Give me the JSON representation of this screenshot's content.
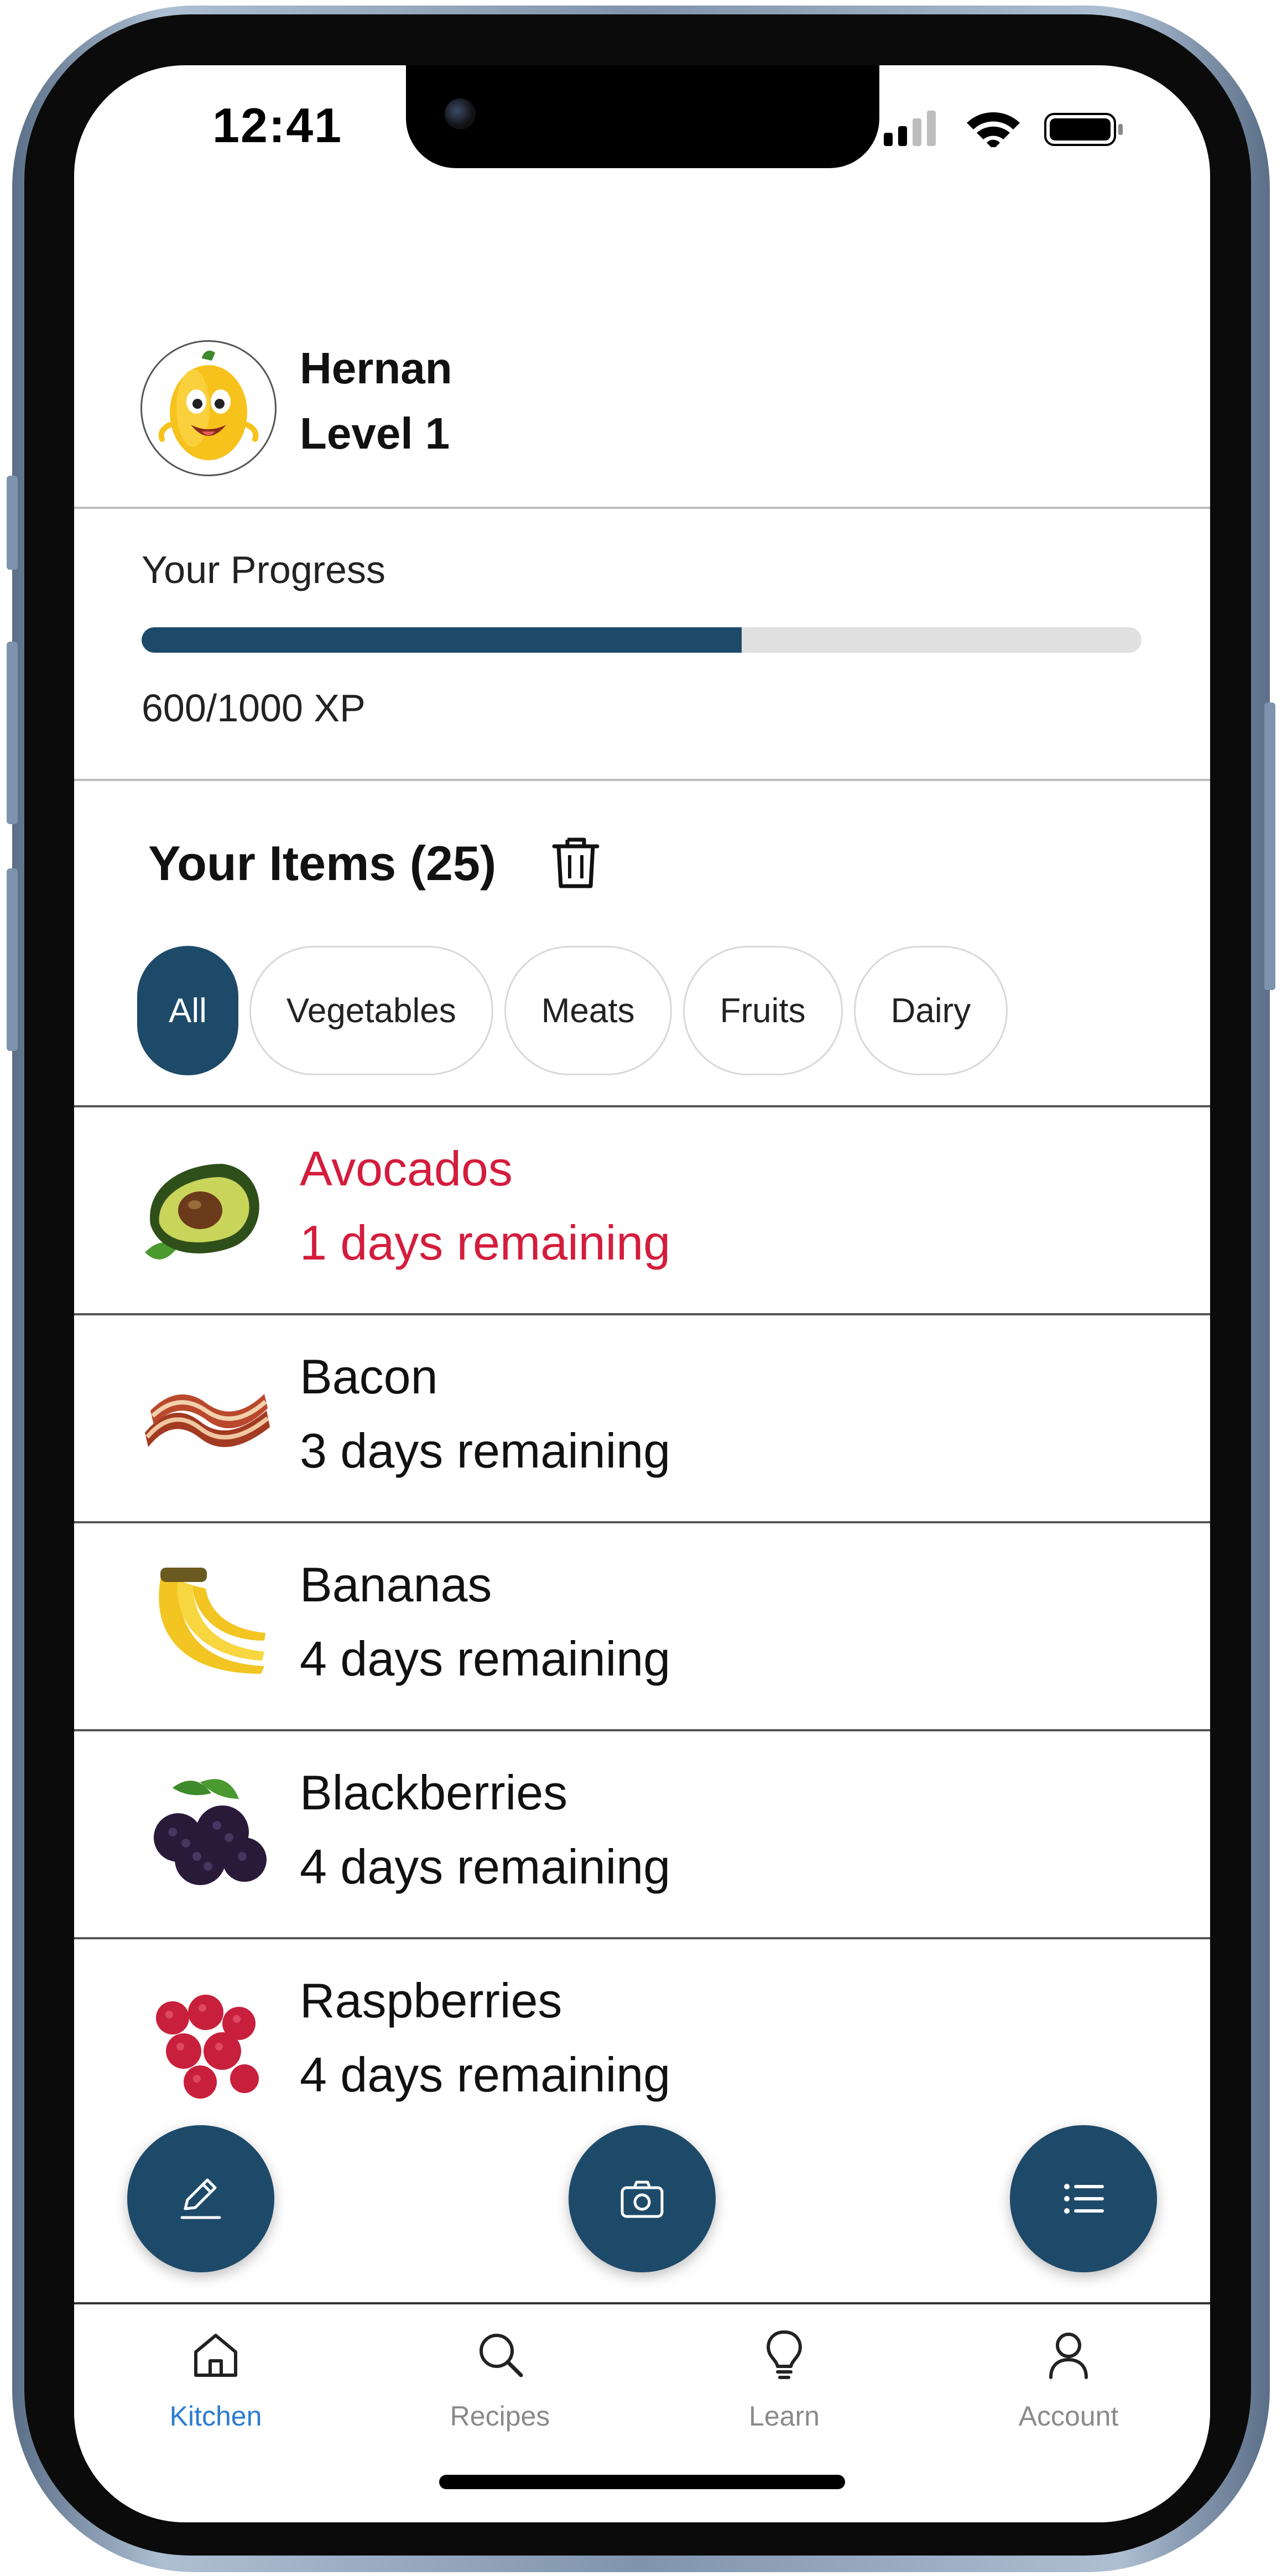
{
  "status_bar": {
    "time": "12:41"
  },
  "profile": {
    "name": "Hernan",
    "level": "Level 1",
    "avatar_icon": "bell-pepper-avatar"
  },
  "progress": {
    "label": "Your Progress",
    "xp_text": "600/1000 XP",
    "fraction": 0.6
  },
  "items_section": {
    "title": "Your Items (25)",
    "filters": [
      "All",
      "Vegetables",
      "Meats",
      "Fruits",
      "Dairy"
    ],
    "active_filter": "All"
  },
  "items": [
    {
      "name": "Avocados",
      "remaining": "1 days remaining",
      "icon": "avocado",
      "urgent": true
    },
    {
      "name": "Bacon",
      "remaining": "3 days remaining",
      "icon": "bacon",
      "urgent": false
    },
    {
      "name": "Bananas",
      "remaining": "4 days remaining",
      "icon": "banana",
      "urgent": false
    },
    {
      "name": "Blackberries",
      "remaining": "4 days remaining",
      "icon": "blackberry",
      "urgent": false
    },
    {
      "name": "Raspberries",
      "remaining": "4 days remaining",
      "icon": "raspberry",
      "urgent": false
    }
  ],
  "fabs": [
    "pencil-icon",
    "camera-icon",
    "list-icon"
  ],
  "tabs": [
    {
      "label": "Kitchen",
      "icon": "home-icon",
      "active": true
    },
    {
      "label": "Recipes",
      "icon": "search-icon",
      "active": false
    },
    {
      "label": "Learn",
      "icon": "lightbulb-icon",
      "active": false
    },
    {
      "label": "Account",
      "icon": "person-icon",
      "active": false
    }
  ],
  "colors": {
    "accent": "#1e4a6a",
    "urgent": "#d41c3c",
    "tab_active": "#2a7bd0",
    "tab_inactive": "#8a8a8a"
  }
}
